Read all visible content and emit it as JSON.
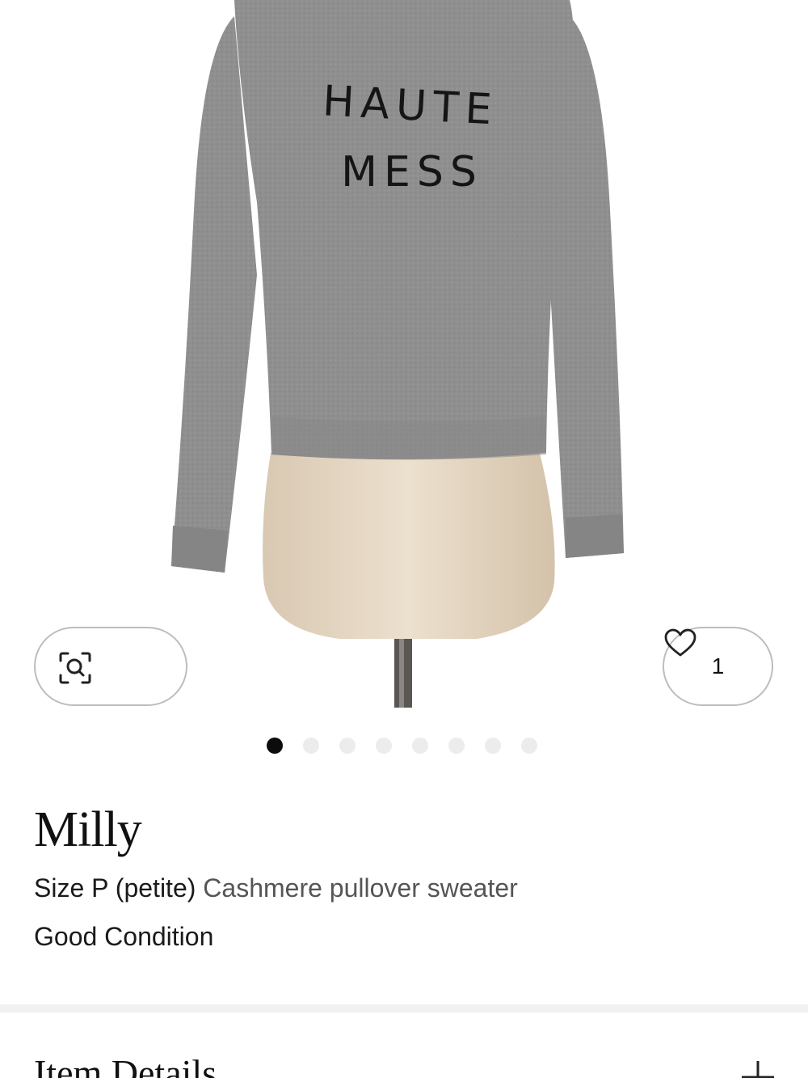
{
  "product_image": {
    "alt": "Gray cashmere pullover sweater on mannequin",
    "print_line1": "HAUTE",
    "print_line2": "MESS"
  },
  "image_controls": {
    "visual_search_icon": "scan-search-icon",
    "like_count": "1",
    "like_icon": "heart-outline-icon"
  },
  "carousel": {
    "total": 8,
    "active_index": 0
  },
  "product": {
    "brand": "Milly",
    "size": "Size P (petite)",
    "description": "Cashmere pullover sweater",
    "condition": "Good Condition"
  },
  "sections": {
    "item_details_label": "Item Details",
    "expand_icon": "plus-icon"
  },
  "colors": {
    "sweater": "#8f8f8f",
    "mannequin": "#e6d8c4",
    "active_dot": "#0c0c0c",
    "inactive_dot": "#ececec",
    "divider": "#f1f1ef"
  }
}
